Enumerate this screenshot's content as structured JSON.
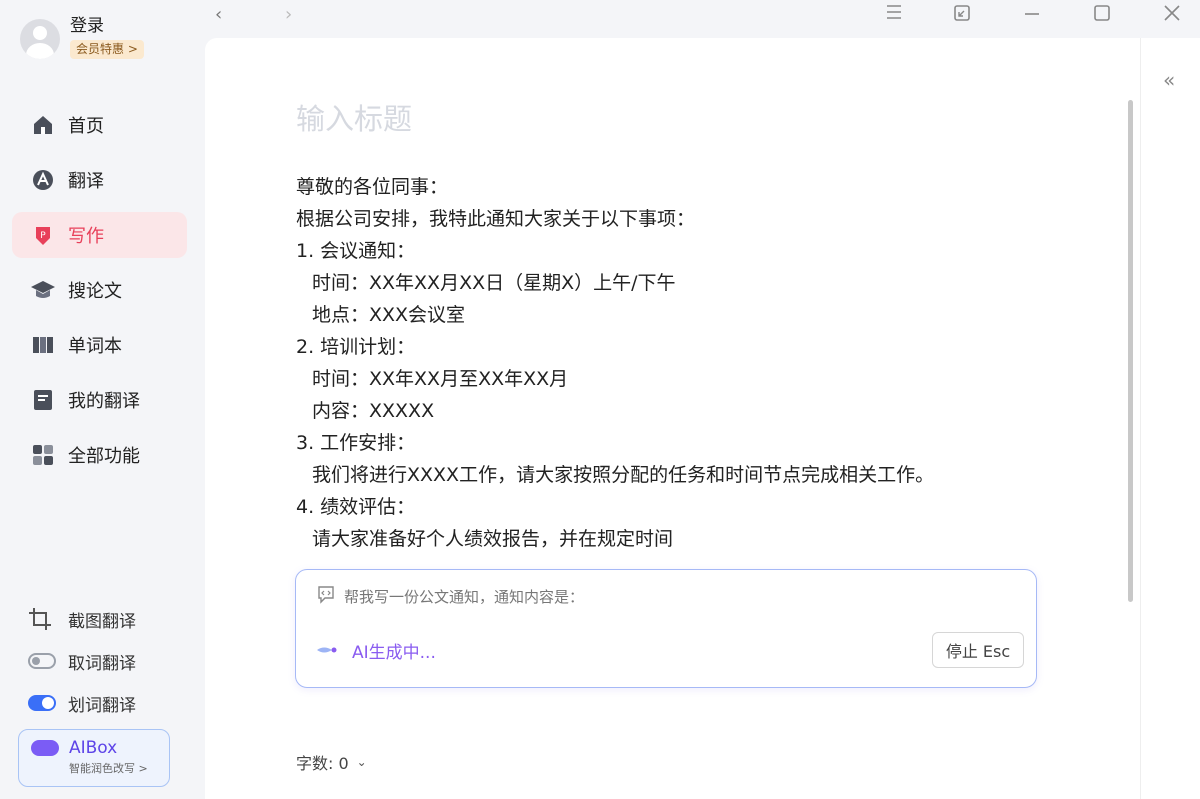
{
  "user": {
    "login": "登录",
    "vip": "会员特惠 >"
  },
  "nav": [
    {
      "label": "首页",
      "icon": "home-icon"
    },
    {
      "label": "翻译",
      "icon": "translate-icon"
    },
    {
      "label": "写作",
      "icon": "writing-icon",
      "active": true
    },
    {
      "label": "搜论文",
      "icon": "paper-search-icon"
    },
    {
      "label": "单词本",
      "icon": "wordbook-icon"
    },
    {
      "label": "我的翻译",
      "icon": "my-translation-icon"
    },
    {
      "label": "全部功能",
      "icon": "all-features-icon"
    }
  ],
  "tools": [
    {
      "label": "截图翻译",
      "icon": "crop-icon"
    },
    {
      "label": "取词翻译",
      "state": "off"
    },
    {
      "label": "划词翻译",
      "state": "on"
    }
  ],
  "aibox": {
    "title": "AIBox",
    "subtitle": "智能润色改写 >"
  },
  "editor": {
    "title_placeholder": "输入标题",
    "lines": [
      "尊敬的各位同事：",
      "根据公司安排，我特此通知大家关于以下事项：",
      "1. 会议通知：",
      "时间：XX年XX月XX日（星期X）上午/下午",
      "地点：XXX会议室",
      "2. 培训计划：",
      "时间：XX年XX月至XX年XX月",
      "内容：XXXXX",
      "3. 工作安排：",
      "我们将进行XXXX工作，请大家按照分配的任务和时间节点完成相关工作。",
      "4. 绩效评估：",
      "请大家准备好个人绩效报告，并在规定时间"
    ],
    "prompt": "帮我写一份公文通知，通知内容是：",
    "generating": "AI生成中...",
    "stop_label": "停止 Esc",
    "word_count": "字数: 0"
  },
  "colors": {
    "accent": "#e8405a",
    "ai_purple": "#8a5cf0",
    "switch_blue": "#3a6ff7"
  }
}
